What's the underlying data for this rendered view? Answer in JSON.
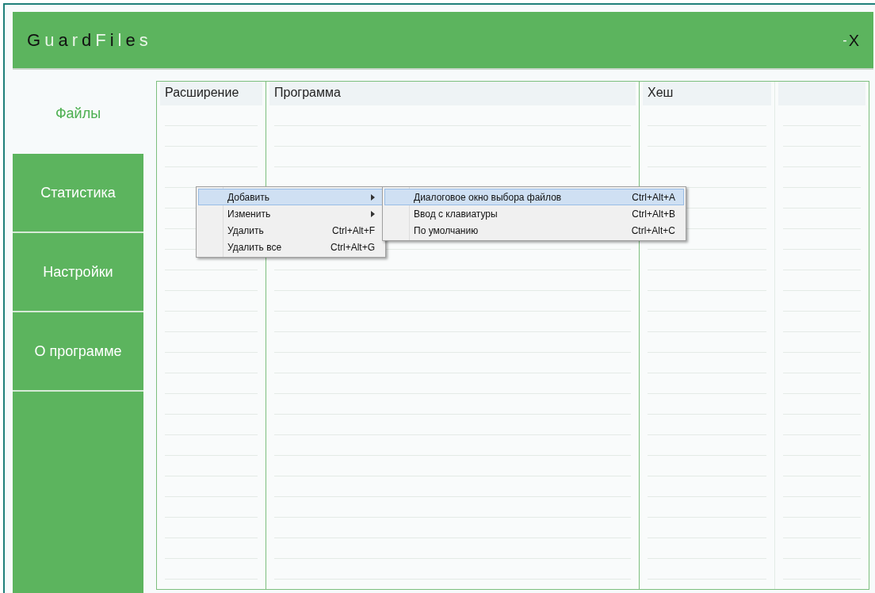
{
  "window": {
    "title": "GuardFiles",
    "minimize": "-",
    "close": "X"
  },
  "tabs": [
    {
      "label": "Файлы",
      "selected": true
    },
    {
      "label": "Статистика",
      "selected": false
    },
    {
      "label": "Настройки",
      "selected": false
    },
    {
      "label": "О программе",
      "selected": false
    }
  ],
  "table": {
    "columns": [
      "Расширение",
      "Программа",
      "Хеш"
    ]
  },
  "context_menu": {
    "items": [
      {
        "label": "Добавить",
        "has_submenu": true,
        "selected": true
      },
      {
        "label": "Изменить",
        "has_submenu": true,
        "selected": false
      },
      {
        "label": "Удалить",
        "shortcut": "Ctrl+Alt+F",
        "has_submenu": false,
        "selected": false
      },
      {
        "label": "Удалить все",
        "shortcut": "Ctrl+Alt+G",
        "has_submenu": false,
        "selected": false
      }
    ],
    "submenu": [
      {
        "label": "Диалоговое окно выбора файлов",
        "shortcut": "Ctrl+Alt+A",
        "selected": true
      },
      {
        "label": "Ввод с клавиатуры",
        "shortcut": "Ctrl+Alt+B",
        "selected": false
      },
      {
        "label": "По умолчанию",
        "shortcut": "Ctrl+Alt+C",
        "selected": false
      }
    ]
  }
}
